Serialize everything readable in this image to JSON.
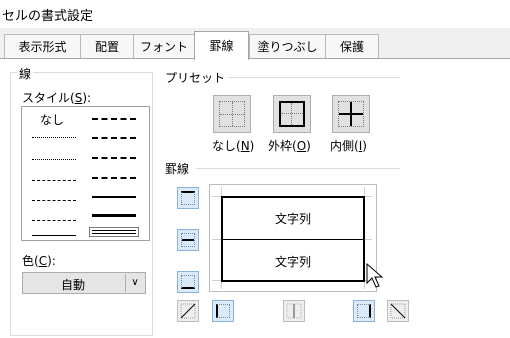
{
  "window": {
    "title": "セルの書式設定"
  },
  "tabs": [
    {
      "label": "表示形式"
    },
    {
      "label": "配置"
    },
    {
      "label": "フォント"
    },
    {
      "label": "罫線"
    },
    {
      "label": "塗りつぶし"
    },
    {
      "label": "保護"
    }
  ],
  "line_group": {
    "title": "線",
    "style_label": "スタイル(",
    "style_key": "S",
    "style_end": "):",
    "none_label": "なし",
    "color_label": "色(",
    "color_key": "C",
    "color_end": "):",
    "color_value": "自動"
  },
  "preset_group": {
    "title": "プリセット",
    "none_label": "なし(",
    "none_key": "N",
    "outline_label": "外枠(",
    "outline_key": "O",
    "inside_label": "内側(",
    "inside_key": "I",
    "close": ")"
  },
  "border_group": {
    "title": "罫線",
    "cell_text_top": "文字列",
    "cell_text_bottom": "文字列"
  },
  "icons": {
    "dropdown": "chevron-down-icon",
    "cursor": "mouse-pointer-icon"
  }
}
